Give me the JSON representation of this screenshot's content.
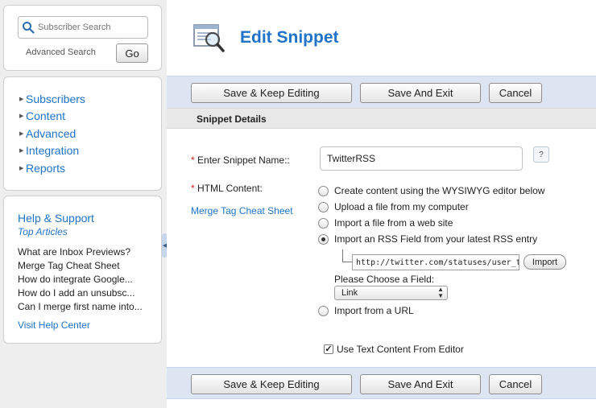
{
  "sidebar": {
    "search": {
      "placeholder": "Subscriber Search",
      "advanced_label": "Advanced Search",
      "go_label": "Go"
    },
    "nav": [
      {
        "label": "Subscribers"
      },
      {
        "label": "Content"
      },
      {
        "label": "Advanced"
      },
      {
        "label": "Integration"
      },
      {
        "label": "Reports"
      }
    ],
    "help": {
      "title": "Help & Support",
      "subtitle": "Top Articles",
      "articles": [
        "What are Inbox Previews?",
        "Merge Tag Cheat Sheet",
        "How do integrate Google...",
        "How do I add an unsubsc...",
        "Can I merge first name into..."
      ],
      "visit_label": "Visit Help Center"
    }
  },
  "header": {
    "title": "Edit Snippet"
  },
  "toolbar": {
    "save_keep_label": "Save & Keep Editing",
    "save_exit_label": "Save And Exit",
    "cancel_label": "Cancel"
  },
  "section": {
    "title": "Snippet Details"
  },
  "form": {
    "name_label": "Enter Snippet Name::",
    "name_value": "TwitterRSS",
    "help_icon": "?",
    "html_label": "HTML Content:",
    "merge_link": "Merge Tag Cheat Sheet",
    "options": [
      {
        "label": "Create content using the WYSIWYG editor below",
        "checked": false
      },
      {
        "label": "Upload a file from my computer",
        "checked": false
      },
      {
        "label": "Import a file from a web site",
        "checked": false
      },
      {
        "label": "Import an RSS Field from your latest RSS entry",
        "checked": true
      },
      {
        "label": "Import from a URL",
        "checked": false
      }
    ],
    "rss_url": "http://twitter.com/statuses/user_tim",
    "import_label": "Import",
    "field_prompt": "Please Choose a Field:",
    "field_selected": "Link",
    "use_text_label": "Use Text Content From Editor",
    "use_text_checked": true,
    "required_mark": "*"
  },
  "colors": {
    "link_blue": "#1f73c8",
    "toolbar_bg": "#dde5f3",
    "required_red": "#cc2222"
  },
  "icons": [
    "search-icon",
    "snippet-magnifier-icon",
    "question-icon",
    "chevron-down-icon",
    "arrow-right-icon",
    "collapse-arrow-icon",
    "checkmark-icon"
  ]
}
